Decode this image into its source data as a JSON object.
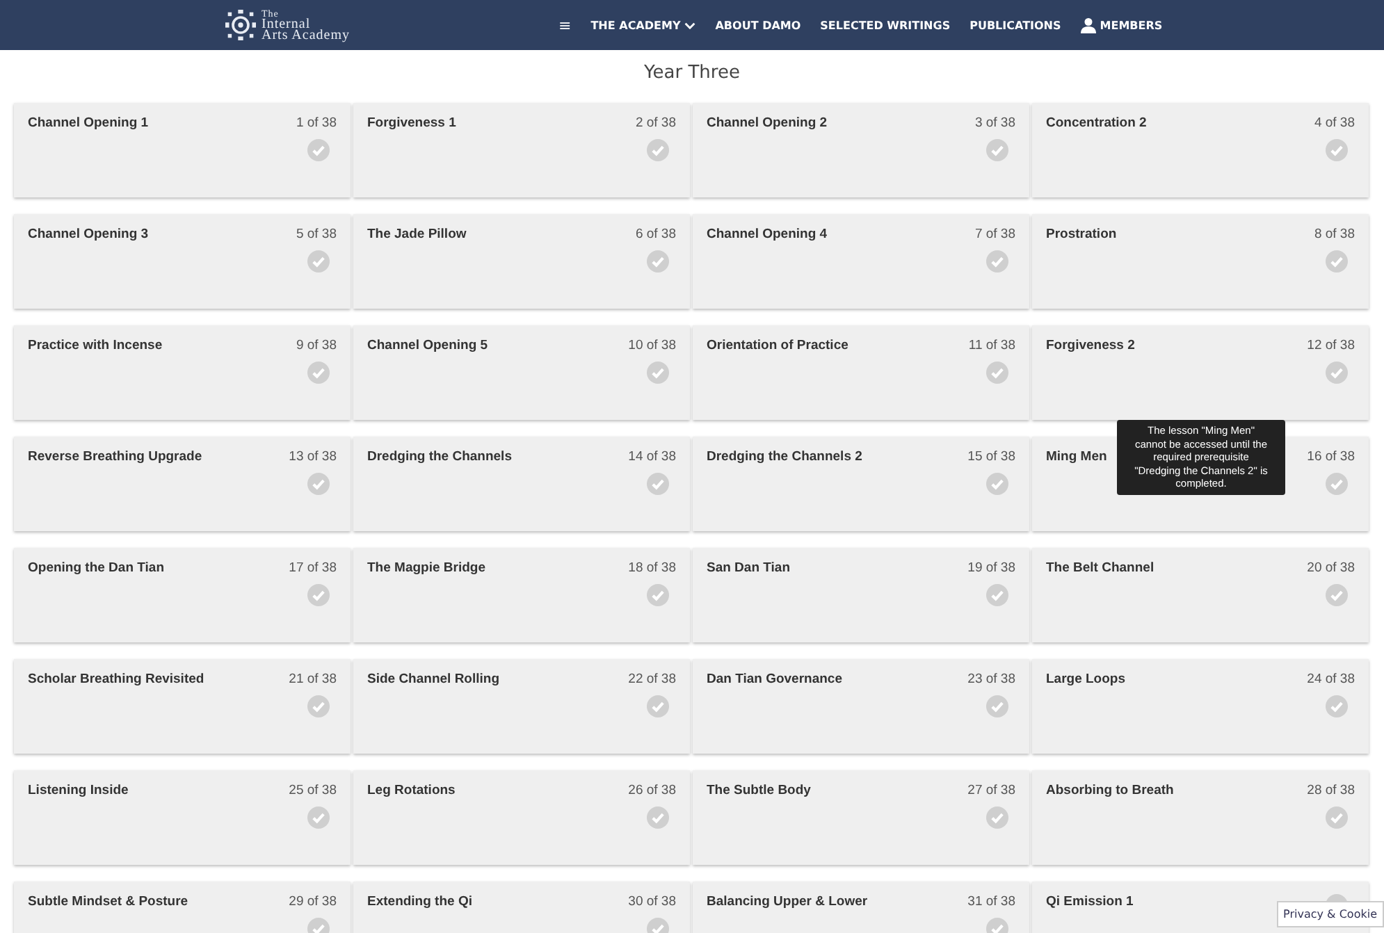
{
  "header": {
    "logo_lines": [
      "The",
      "Internal",
      "Arts Academy"
    ],
    "nav": [
      {
        "label": "≡",
        "kind": "menu"
      },
      {
        "label": "THE ACADEMY",
        "kind": "dropdown"
      },
      {
        "label": "ABOUT DAMO",
        "kind": "link"
      },
      {
        "label": "SELECTED WRITINGS",
        "kind": "link"
      },
      {
        "label": "PUBLICATIONS",
        "kind": "link"
      },
      {
        "label": "MEMBERS",
        "kind": "user"
      }
    ]
  },
  "heading": "Year Three",
  "lessons": [
    {
      "title": "Channel Opening 1",
      "count": "1 of 38"
    },
    {
      "title": "Forgiveness 1",
      "count": "2 of 38"
    },
    {
      "title": "Channel Opening 2",
      "count": "3 of 38"
    },
    {
      "title": "Concentration 2",
      "count": "4 of 38"
    },
    {
      "title": "Channel Opening 3",
      "count": "5 of 38"
    },
    {
      "title": "The Jade Pillow",
      "count": "6 of 38"
    },
    {
      "title": "Channel Opening 4",
      "count": "7 of 38"
    },
    {
      "title": "Prostration",
      "count": "8 of 38"
    },
    {
      "title": "Practice with Incense",
      "count": "9 of 38"
    },
    {
      "title": "Channel Opening 5",
      "count": "10 of 38"
    },
    {
      "title": "Orientation of Practice",
      "count": "11 of 38"
    },
    {
      "title": "Forgiveness 2",
      "count": "12 of 38"
    },
    {
      "title": "Reverse Breathing Upgrade",
      "count": "13 of 38"
    },
    {
      "title": "Dredging the Channels",
      "count": "14 of 38"
    },
    {
      "title": "Dredging the Channels 2",
      "count": "15 of 38"
    },
    {
      "title": "Ming Men",
      "count": "16 of 38"
    },
    {
      "title": "Opening the Dan Tian",
      "count": "17 of 38"
    },
    {
      "title": "The Magpie Bridge",
      "count": "18 of 38"
    },
    {
      "title": "San Dan Tian",
      "count": "19 of 38"
    },
    {
      "title": "The Belt Channel",
      "count": "20 of 38"
    },
    {
      "title": "Scholar Breathing Revisited",
      "count": "21 of 38"
    },
    {
      "title": "Side Channel Rolling",
      "count": "22 of 38"
    },
    {
      "title": "Dan Tian Governance",
      "count": "23 of 38"
    },
    {
      "title": "Large Loops",
      "count": "24 of 38"
    },
    {
      "title": "Listening Inside",
      "count": "25 of 38"
    },
    {
      "title": "Leg Rotations",
      "count": "26 of 38"
    },
    {
      "title": "The Subtle Body",
      "count": "27 of 38"
    },
    {
      "title": "Absorbing to Breath",
      "count": "28 of 38"
    },
    {
      "title": "Subtle Mindset & Posture",
      "count": "29 of 38"
    },
    {
      "title": "Extending the Qi",
      "count": "30 of 38"
    },
    {
      "title": "Balancing Upper & Lower",
      "count": "31 of 38"
    },
    {
      "title": "Qi Emission 1"
    }
  ],
  "tooltip": "The lesson \"Ming Men\" cannot be accessed until the required prerequisite \"Dredging the Channels 2\" is completed.",
  "privacy_badge": "Privacy & Cookie"
}
